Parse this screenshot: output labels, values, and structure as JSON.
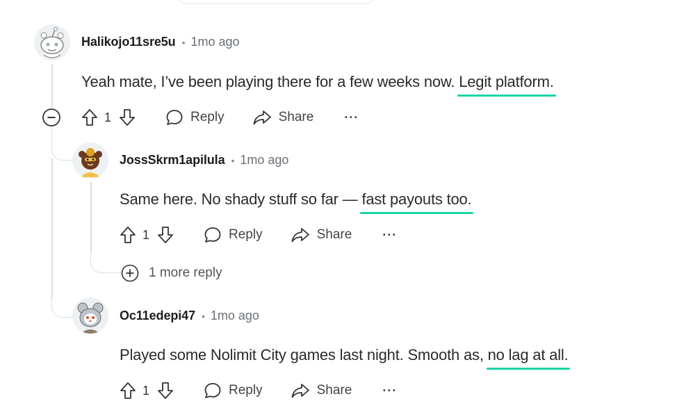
{
  "comments": [
    {
      "username": "Halikojo11sre5u",
      "time": "1mo ago",
      "text_before": "Yeah mate, I’ve been playing there for a few weeks now. ",
      "text_highlight": "Legit platform.",
      "votes": "1",
      "reply_label": "Reply",
      "share_label": "Share",
      "more_label": "···"
    },
    {
      "username": "JossSkrm1apilula",
      "time": "1mo ago",
      "text_before": "Same here. No shady stuff so far — ",
      "text_highlight": "fast payouts too.",
      "votes": "1",
      "reply_label": "Reply",
      "share_label": "Share",
      "more_label": "···"
    },
    {
      "username": "Oc11edepi47",
      "time": "1mo ago",
      "text_before": "Played some Nolimit City games last night. Smooth as, ",
      "text_highlight": "no lag at all.",
      "votes": "1",
      "reply_label": "Reply",
      "share_label": "Share",
      "more_label": "···"
    }
  ],
  "more_replies_label": "1 more reply",
  "meta_separator": "•",
  "colors": {
    "highlight_underline": "#19d4a6",
    "thread_line": "#d9dde0"
  },
  "icons": [
    "collapse-icon",
    "upvote-icon",
    "downvote-icon",
    "reply-icon",
    "share-icon",
    "expand-icon"
  ]
}
